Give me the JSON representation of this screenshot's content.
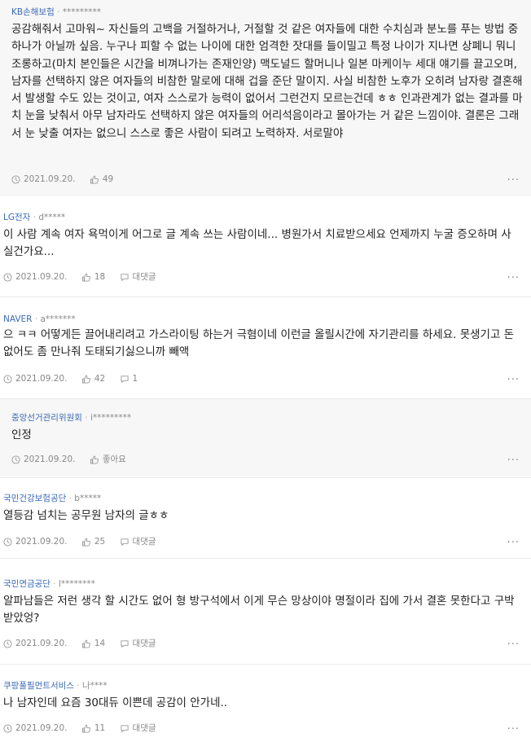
{
  "comments": [
    {
      "company": "KB손해보험",
      "user": "*********",
      "body": "공감해줘서 고마워~ 자신들의 고백을 거절하거나, 거절할 것 같은 여자들에 대한 수치심과 분노를 푸는 방법 중 하나가 아닐까 싶음. 누구나 피할 수 없는 나이에 대한 엄격한 잣대를 들이밀고 특정 나이가 지나면 상폐니 뭐니 조롱하고(마치 본인들은 시간을 비껴나가는 존재인양) 맥도널드 할머니나 일본 마케이누 세대 얘기를 끌고오며, 남자를 선택하지 않은 여자들의 비참한 말로에 대해 겁을 준단 말이지. 사실 비참한 노후가 오히려 남자랑 결혼해서 발생할 수도 있는 것이고, 여자 스스로가 능력이 없어서 그런건지 모르는건데 ㅎㅎ 인과관계가 없는 결과를 마치 눈을 낮춰서 아무 남자라도 선택하지 않은 여자들의 어리석음이라고 몰아가는 거 같은 느낌이야. 결론은 그래서 눈 낮출 여자는 없으니 스스로 좋은 사람이 되려고 노력하자. 서로말야",
      "date": "2021.09.20.",
      "likes": "49",
      "reply": ""
    },
    {
      "company": "LG전자",
      "user": "d*****",
      "body": "이 사람 계속 여자 욕먹이게 어그로 글 계속 쓰는 사람이네... 병원가서 치료받으세요 언제까지 누굴 증오하며 사실건가요...",
      "date": "2021.09.20.",
      "likes": "18",
      "reply": "대댓글"
    },
    {
      "company": "NAVER",
      "user": "a*******",
      "body": "으 ㅋㅋ 어떻게든 끌어내리려고 가스라이팅 하는거 극혐이네 이런글 올릴시간에 자기관리를 하세요. 못생기고 돈없어도 좀 만나줘 도태되기싫으니까 빼액",
      "date": "2021.09.20.",
      "likes": "42",
      "reply": "1"
    },
    {
      "company": "중앙선거관리위원회",
      "user": "i*********",
      "body": "인정",
      "date": "2021.09.20.",
      "likes": "좋아요",
      "reply": ""
    },
    {
      "company": "국민건강보험공단",
      "user": "b*****",
      "body": "열등감 넘치는 공무원 남자의 글ㅎㅎ",
      "date": "2021.09.20.",
      "likes": "25",
      "reply": "대댓글"
    },
    {
      "company": "국민연금공단",
      "user": "l********",
      "body": "알파남들은 저런 생각 할 시간도 없어 형 방구석에서 이게 무슨 망상이야 명절이라 집에 가서 결혼 못한다고 구박받았엉?",
      "date": "2021.09.20.",
      "likes": "14",
      "reply": "대댓글"
    },
    {
      "company": "쿠팡풀필먼트서비스",
      "user": "나****",
      "body": "나 남자인데 요즘 30대듀 이쁜데 공감이 안가네..",
      "date": "2021.09.20.",
      "likes": "11",
      "reply": "대댓글"
    }
  ],
  "icons": {
    "time": "clock-icon",
    "like": "thumbs-up-icon",
    "reply": "speech-bubble-icon",
    "more": "more-dots-icon"
  },
  "colors": {
    "company": "#3a6ab7",
    "meta": "#999999",
    "shaded_bg": "#f7f7f7"
  }
}
